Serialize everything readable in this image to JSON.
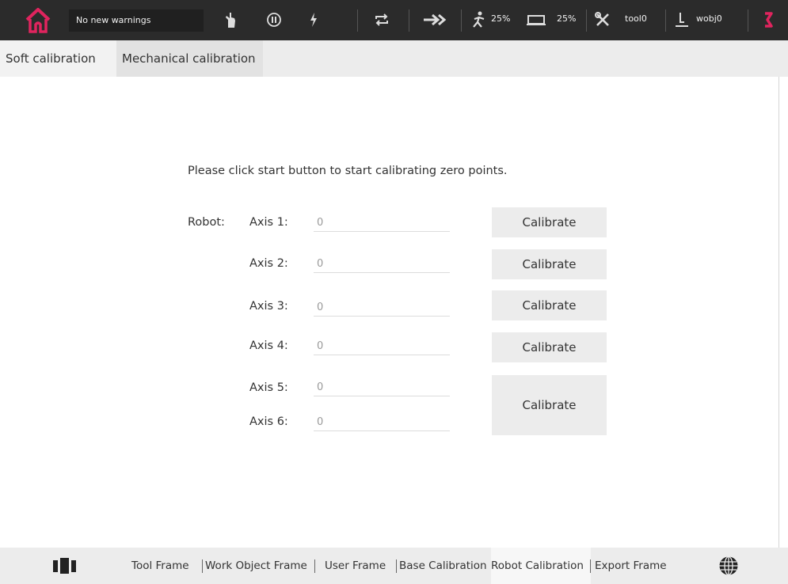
{
  "topbar": {
    "warning_text": "No new warnings",
    "speed_run": "25%",
    "speed_display": "25%",
    "tool": "tool0",
    "wobj": "wobj0",
    "icons": [
      "home-icon",
      "hand-icon",
      "pause-icon",
      "lightning-icon",
      "repeat-icon",
      "arrow-right-icon",
      "running-man-icon",
      "monitor-icon",
      "tools-icon",
      "joystick-icon",
      "robot-arm-icon"
    ],
    "accent": "#e0245e"
  },
  "tabs": [
    {
      "label": "Soft calibration"
    },
    {
      "label": "Mechanical calibration"
    }
  ],
  "main": {
    "instruction": "Please click start button to start calibrating zero points.",
    "robot_label": "Robot:",
    "axes": [
      {
        "label": "Axis 1:",
        "value": "0"
      },
      {
        "label": "Axis 2:",
        "value": "0"
      },
      {
        "label": "Axis 3:",
        "value": "0"
      },
      {
        "label": "Axis 4:",
        "value": "0"
      },
      {
        "label": "Axis 5:",
        "value": "0"
      },
      {
        "label": "Axis 6:",
        "value": "0"
      }
    ],
    "calibrate_label": "Calibrate"
  },
  "bottom": {
    "items": [
      {
        "label": "Tool Frame"
      },
      {
        "label": "Work Object Frame"
      },
      {
        "label": "User Frame"
      },
      {
        "label": "Base Calibration"
      },
      {
        "label": "Robot Calibration"
      },
      {
        "label": "Export Frame"
      }
    ],
    "icons": [
      "panels-icon",
      "globe-icon"
    ]
  }
}
